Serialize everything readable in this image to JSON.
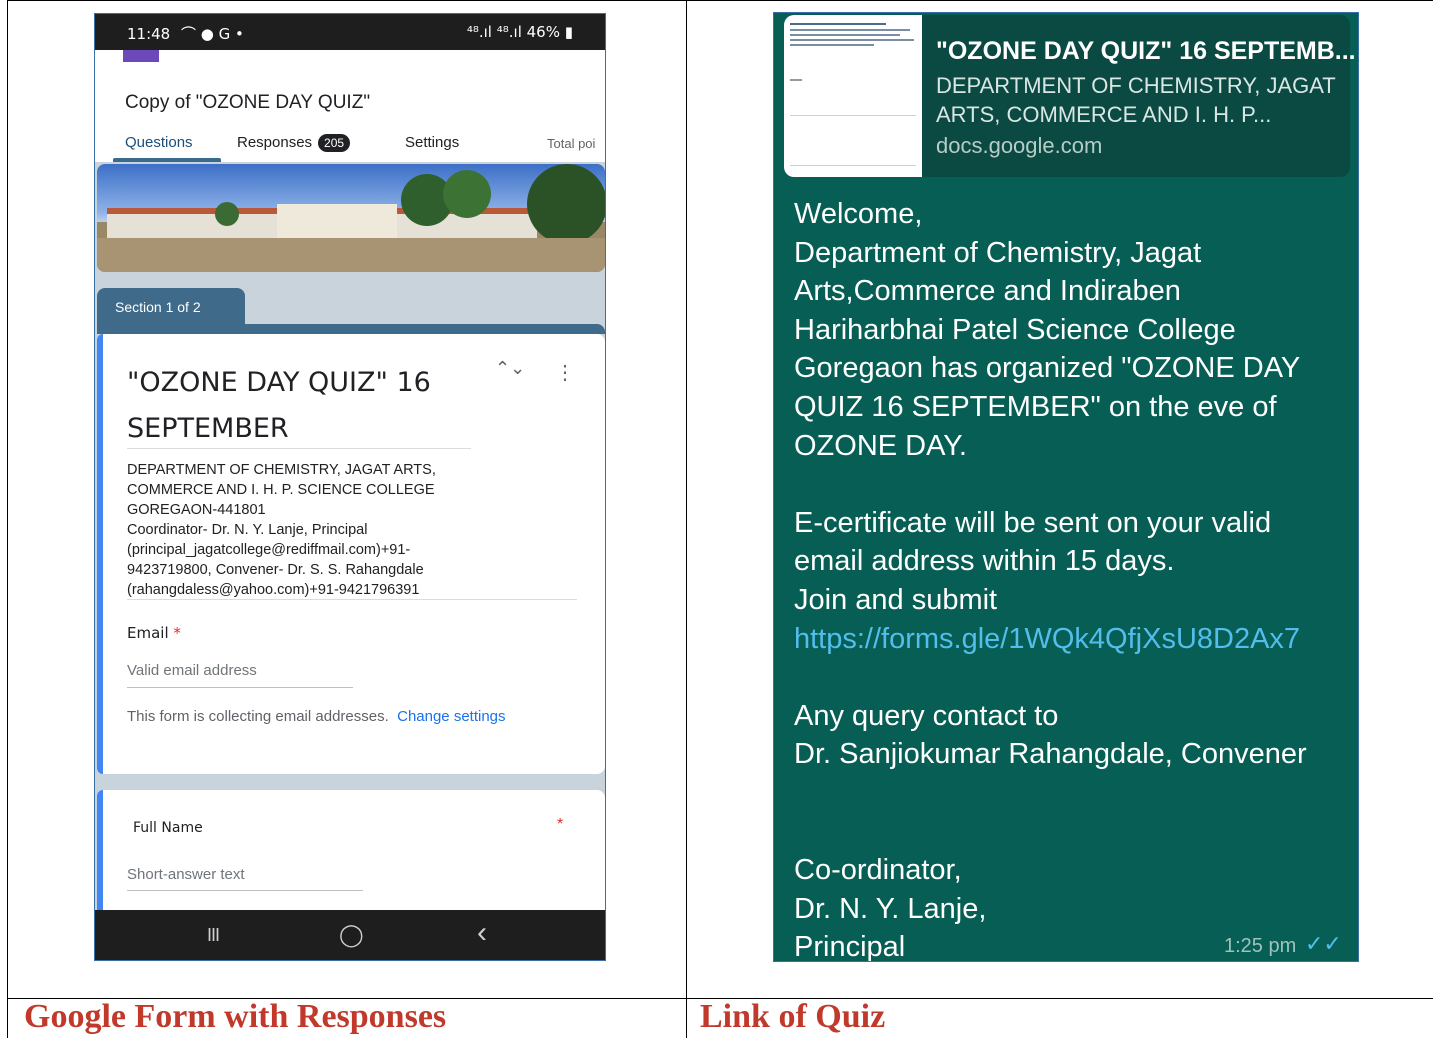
{
  "left_phone": {
    "status_time": "11:48",
    "status_icons": "⌒ ● G •",
    "status_right": "⁴⁸.ıl ⁴⁸.ıl 46% ▮",
    "form_title": "Copy of  \"OZONE DAY QUIZ\"",
    "tabs": {
      "questions": "Questions",
      "responses": "Responses",
      "responses_count": "205",
      "settings": "Settings",
      "total_points": "Total poi"
    },
    "section_label": "Section 1 of 2",
    "quiz_title": "\"OZONE DAY QUIZ\" 16 SEPTEMBER",
    "description_lines": [
      "DEPARTMENT OF CHEMISTRY, JAGAT ARTS,",
      "COMMERCE AND I. H. P. SCIENCE COLLEGE",
      "GOREGAON-441801",
      "Coordinator- Dr. N. Y. Lanje, Principal",
      "(principal_jagatcollege@rediffmail.com)+91-",
      "9423719800, Convener- Dr. S. S. Rahangdale",
      "(rahangdaless@yahoo.com)+91-9421796391"
    ],
    "email_label": "Email",
    "required_mark": "*",
    "email_placeholder": "Valid email address",
    "collect_note": "This form is collecting email addresses.",
    "change_link": "Change settings",
    "fullname_label": "Full Name",
    "fullname_placeholder": "Short-answer text",
    "nav": {
      "recent": "III",
      "home": "◯",
      "back": "‹"
    }
  },
  "right_phone": {
    "preview_title": "\"OZONE DAY QUIZ\" 16 SEPTEMB...",
    "preview_desc": "DEPARTMENT OF CHEMISTRY, JAGAT ARTS, COMMERCE AND I. H. P...",
    "preview_domain": "docs.google.com",
    "message_lines": [
      "Welcome,",
      "Department of Chemistry, Jagat",
      "Arts,Commerce and Indiraben",
      "Hariharbhai Patel Science College",
      "Goregaon has organized \"OZONE DAY",
      "QUIZ 16 SEPTEMBER\" on the eve of",
      "OZONE DAY.",
      "",
      "E-certificate will  be sent on your valid",
      "email address within 15 days.",
      "Join and submit"
    ],
    "message_link": "https://forms.gle/1WQk4QfjXsU8D2Ax7",
    "message_lines_2": [
      "",
      "Any query contact to",
      "Dr. Sanjiokumar Rahangdale, Convener",
      "",
      "",
      "Co-ordinator,",
      "Dr. N. Y. Lanje,",
      "Principal"
    ],
    "timestamp": "1:25 pm",
    "read_ticks": "✓✓"
  },
  "captions": {
    "left": "Google Form with Responses",
    "right": "Link of Quiz"
  },
  "colors": {
    "caption": "#c0392b",
    "chat_bg": "#075e54",
    "link": "#53bdeb",
    "card_accent": "#4285f4",
    "section_tab": "#3f6a8a"
  }
}
